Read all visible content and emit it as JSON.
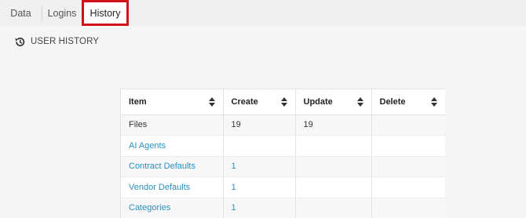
{
  "tabs": [
    {
      "label": "Data",
      "active": false
    },
    {
      "label": "Logins",
      "active": false
    },
    {
      "label": "History",
      "active": true
    }
  ],
  "section": {
    "icon": "history-icon",
    "title": "USER HISTORY"
  },
  "table": {
    "columns": [
      "Item",
      "Create",
      "Update",
      "Delete"
    ],
    "rows": [
      {
        "item": "Files",
        "create": "19",
        "update": "19",
        "delete": "",
        "link": false
      },
      {
        "item": "AI Agents",
        "create": "",
        "update": "",
        "delete": "",
        "link": true
      },
      {
        "item": "Contract Defaults",
        "create": "1",
        "update": "",
        "delete": "",
        "link": true
      },
      {
        "item": "Vendor Defaults",
        "create": "1",
        "update": "",
        "delete": "",
        "link": true
      },
      {
        "item": "Categories",
        "create": "1",
        "update": "",
        "delete": "",
        "link": true
      }
    ]
  },
  "colors": {
    "accent_link": "#2a8fc0",
    "highlight": "#d0121b"
  }
}
